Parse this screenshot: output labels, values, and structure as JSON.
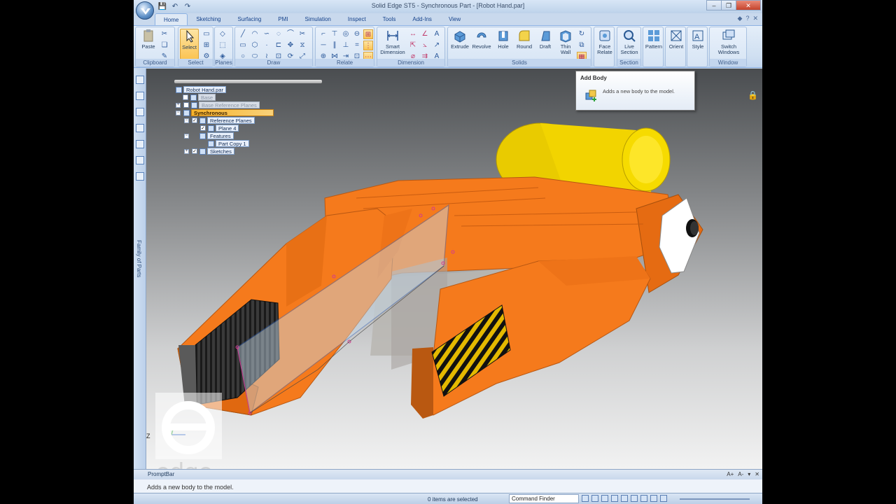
{
  "window": {
    "title": "Solid Edge ST5 - Synchronous Part - [Robot Hand.par]",
    "controls": [
      "–",
      "❐",
      "✕"
    ]
  },
  "quick_access": [
    "💾",
    "↶",
    "↷"
  ],
  "tabs": [
    "Home",
    "Sketching",
    "Surfacing",
    "PMI",
    "Simulation",
    "Inspect",
    "Tools",
    "Add-Ins",
    "View"
  ],
  "ribbon": {
    "groups": {
      "clipboard": "Clipboard",
      "select": "Select",
      "planes": "Planes",
      "draw": "Draw",
      "relate": "Relate",
      "dimension": "Dimension",
      "solids": "Solids",
      "section": "Section",
      "window": "Window"
    },
    "buttons": {
      "paste": "Paste",
      "select": "Select",
      "smart_dimension": "Smart Dimension",
      "extrude": "Extrude",
      "revolve": "Revolve",
      "hole": "Hole",
      "round": "Round",
      "draft": "Draft",
      "thin_wall": "Thin Wall",
      "face_relate": "Face Relate",
      "live_section": "Live Section",
      "pattern": "Pattern",
      "orient": "Orient",
      "style": "Style",
      "switch_windows": "Switch Windows"
    }
  },
  "tooltip": {
    "title": "Add Body",
    "body": "Adds a new body to the model."
  },
  "pathfinder": {
    "root": "Robot Hand.par",
    "items": {
      "base": "Base",
      "base_ref_planes": "Base Reference Planes",
      "synchronous": "Synchronous",
      "reference_planes": "Reference Planes",
      "plane4": "Plane 4",
      "features": "Features",
      "part_copy": "Part Copy 1",
      "sketches": "Sketches"
    }
  },
  "sidebar": {
    "family_label": "Family of Parts"
  },
  "watermark": {
    "text": "edge"
  },
  "prompt": {
    "header": "PromptBar",
    "text": "Adds a new body to the model."
  },
  "status": {
    "selection": "0 items are selected",
    "command_finder": "Command Finder"
  },
  "colors": {
    "orange_body": "#f57a1c",
    "yellow_body": "#f2d100",
    "ribbon_bg": "#dfe9f5",
    "highlight": "#fbc453"
  }
}
